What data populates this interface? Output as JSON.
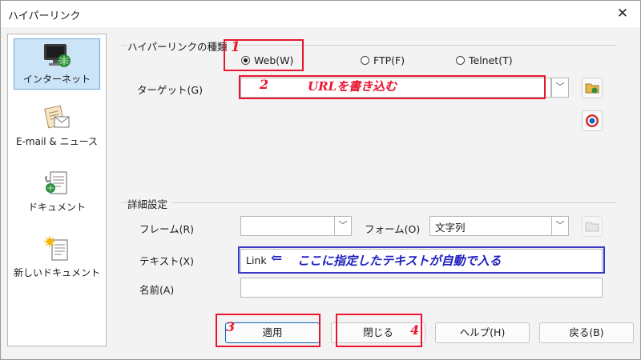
{
  "window": {
    "title": "ハイパーリンク",
    "close_glyph": "✕"
  },
  "sidebar": {
    "items": [
      {
        "label": "インターネット",
        "icon": "internet-monitor-icon",
        "selected": true
      },
      {
        "label": "E-mail & ニュース",
        "icon": "mail-news-icon",
        "selected": false
      },
      {
        "label": "ドキュメント",
        "icon": "document-icon",
        "selected": false
      },
      {
        "label": "新しいドキュメント",
        "icon": "new-document-icon",
        "selected": false
      }
    ]
  },
  "hyperlink_type": {
    "section_label": "ハイパーリンクの種類",
    "options": [
      {
        "label": "Web(W)",
        "selected": true
      },
      {
        "label": "FTP(F)",
        "selected": false
      },
      {
        "label": "Telnet(T)",
        "selected": false
      }
    ]
  },
  "target": {
    "label": "ターゲット(G)",
    "value": ""
  },
  "details": {
    "section_label": "詳細設定",
    "frame": {
      "label": "フレーム(R)",
      "value": ""
    },
    "form": {
      "label": "フォーム(O)",
      "value": "文字列"
    },
    "text": {
      "label": "テキスト(X)",
      "value": "Link"
    },
    "name": {
      "label": "名前(A)",
      "value": ""
    }
  },
  "buttons": {
    "apply": "適用",
    "close": "閉じる",
    "help": "ヘルプ(H)",
    "back": "戻る(B)"
  },
  "annotations": {
    "step1": "1",
    "step2": "2",
    "step2_text": "URLを書き込む",
    "step3": "3",
    "step4": "4",
    "arrow_glyph": "⇐",
    "text_note": "ここに指定したテキストが自動で入る"
  },
  "colors": {
    "annotation_red": "#e8152e",
    "annotation_blue": "#3a3ac8",
    "selection": "#cce4f7"
  }
}
